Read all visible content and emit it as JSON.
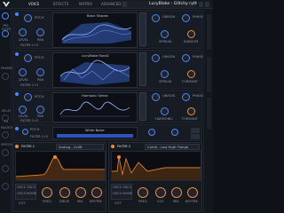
{
  "top": {
    "tabs": [
      "VOICE",
      "EFFECTS",
      "MATRIX",
      "ADVANCED"
    ],
    "active_tab": 0,
    "preset_name": "LucyBlake - Glitchy rythmic"
  },
  "left": {
    "labels": [
      "PRE-FILTER",
      "",
      "PHASER",
      "",
      "DELAY",
      "",
      "FX",
      "",
      "MACROS",
      "",
      "",
      "SPEECH",
      "",
      "",
      ""
    ]
  },
  "oscillators": [
    {
      "wave_name": "Basic Shapes",
      "knobs": [
        {
          "label": "PITCH"
        },
        {
          "label": "LEVEL"
        },
        {
          "label": "PAN"
        }
      ],
      "filter_label": "FILTER 1+2",
      "right_knobs": [
        {
          "label": "UNISON"
        },
        {
          "label": "PHASE"
        },
        {
          "label": "BLEND"
        },
        {
          "label": "RANDOM"
        }
      ],
      "spread_label": "SPREAD",
      "formant_label": "FORMANT"
    },
    {
      "wave_name": "LucyBlake Rand2",
      "knobs": [
        {
          "label": "PITCH"
        },
        {
          "label": "LEVEL"
        },
        {
          "label": "PAN"
        }
      ],
      "filter_label": "FILTER 1+2",
      "right_knobs": [
        {
          "label": "UNISON"
        },
        {
          "label": "PHASE"
        },
        {
          "label": "BLEND"
        },
        {
          "label": "FORMANT"
        }
      ],
      "spread_label": "SPREAD",
      "formant_label": "FORMANT"
    },
    {
      "wave_name": "Harmonic Series",
      "knobs": [
        {
          "label": "PITCH"
        },
        {
          "label": "LEVEL"
        },
        {
          "label": "PAN"
        }
      ],
      "filter_label": "FILTER 1+2",
      "right_knobs": [
        {
          "label": "UNISON"
        },
        {
          "label": "PHASE"
        },
        {
          "label": "HARMONIC"
        },
        {
          "label": "FORMANT"
        }
      ],
      "spread_label": "SPREAD",
      "formant_label": "FORMANT"
    }
  ],
  "noise": {
    "label": "White Noise",
    "knobs": [
      {
        "label": "PITCH"
      },
      {
        "label": "LEVEL"
      },
      {
        "label": "PAN"
      }
    ],
    "filter_label": "FILTER 1+2"
  },
  "filters": [
    {
      "title": "FILTER 1",
      "type": "Analog - 2x48",
      "mix_labels": [
        "FREQ",
        "RES",
        "DRIVE",
        "MIX"
      ],
      "key_labels": [
        "CUT",
        "KEYTRK"
      ],
      "badges": [
        "OSC1",
        "OSC2",
        "OSC3",
        "NOISE"
      ]
    },
    {
      "title": "FILTER 2",
      "type": "Comb - Low High Flange",
      "mix_labels": [
        "FREQ",
        "RES",
        "CUT",
        "MIX"
      ],
      "key_labels": [
        "CUT",
        "KEYTRK"
      ],
      "badges": [
        "OSC1",
        "OSC2",
        "OSC3",
        "NOISE"
      ]
    }
  ],
  "colors": {
    "accent_blue": "#4c86ff",
    "accent_orange": "#f08c2a",
    "bg": "#0e1117"
  }
}
